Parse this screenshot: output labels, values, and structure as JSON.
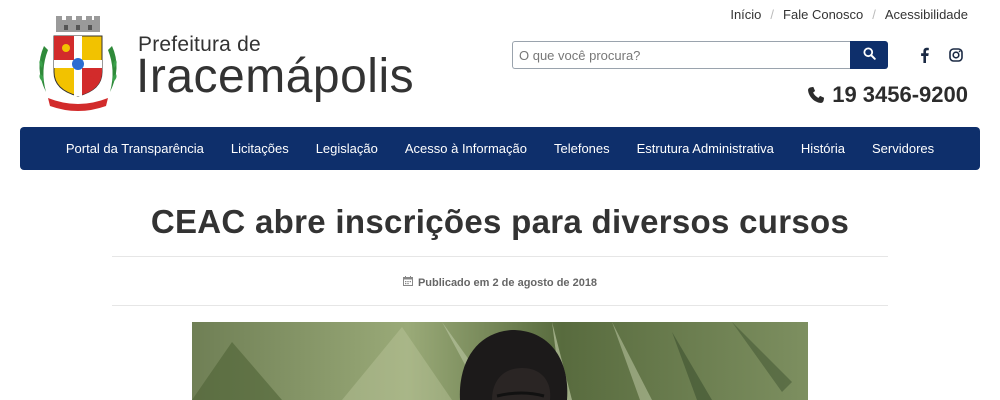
{
  "topnav": {
    "items": [
      {
        "label": "Início"
      },
      {
        "label": "Fale Conosco"
      },
      {
        "label": "Acessibilidade"
      }
    ],
    "separator": "/"
  },
  "brand": {
    "line1": "Prefeitura de",
    "line2": "Iracemápolis"
  },
  "search": {
    "placeholder": "O que você procura?"
  },
  "social": [
    {
      "icon": "facebook-icon"
    },
    {
      "icon": "instagram-icon"
    }
  ],
  "phone": {
    "area_code": "19",
    "number": "3456-9200"
  },
  "mainnav": {
    "items": [
      {
        "label": "Portal da Transparência"
      },
      {
        "label": "Licitações"
      },
      {
        "label": "Legislação"
      },
      {
        "label": "Acesso à Informação"
      },
      {
        "label": "Telefones"
      },
      {
        "label": "Estrutura Administrativa"
      },
      {
        "label": "História"
      },
      {
        "label": "Servidores"
      }
    ]
  },
  "article": {
    "title": "CEAC abre inscrições para diversos cursos",
    "published": "Publicado em 2 de agosto de 2018"
  },
  "colors": {
    "primary": "#0e2f6b",
    "text": "#333333"
  }
}
